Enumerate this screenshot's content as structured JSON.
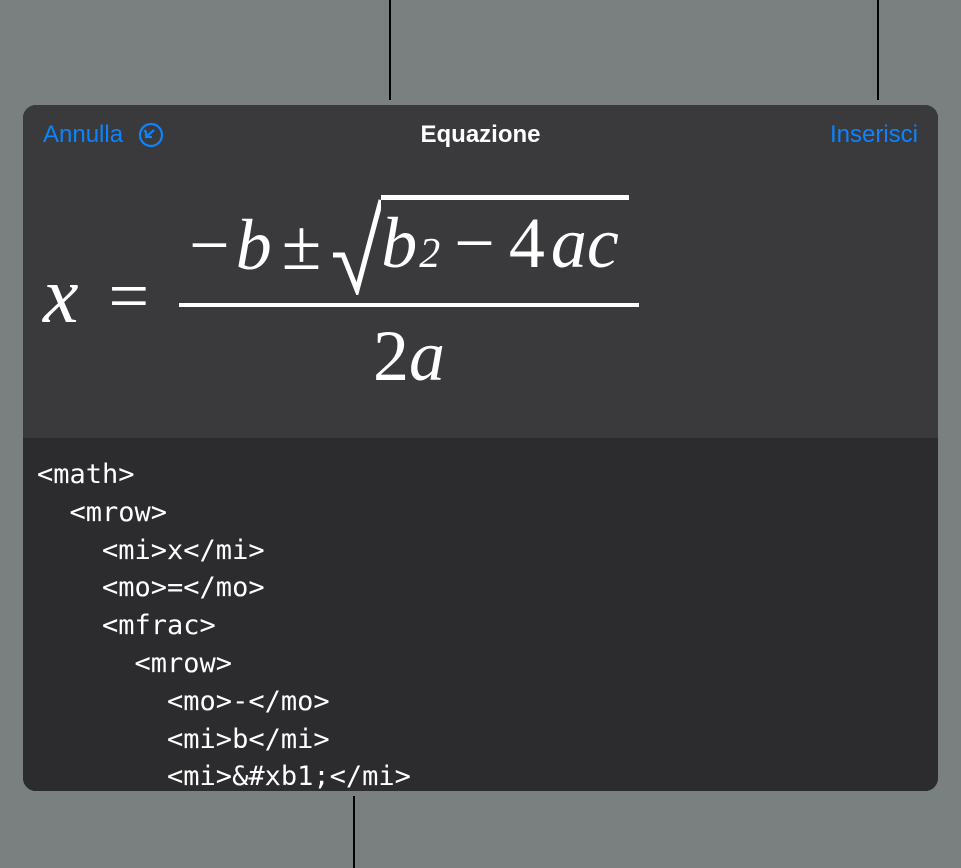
{
  "header": {
    "cancel_label": "Annulla",
    "title": "Equazione",
    "insert_label": "Inserisci"
  },
  "equation": {
    "x": "x",
    "equals": "=",
    "neg": "−",
    "b": "b",
    "pm": "±",
    "b2": "b",
    "exp": "2",
    "minus": "−",
    "four": "4",
    "a": "a",
    "c": "c",
    "two": "2",
    "a2": "a"
  },
  "code": "<math>\n  <mrow>\n    <mi>x</mi>\n    <mo>=</mo>\n    <mfrac>\n      <mrow>\n        <mo>-</mo>\n        <mi>b</mi>\n        <mi>&#xb1;</mi>"
}
